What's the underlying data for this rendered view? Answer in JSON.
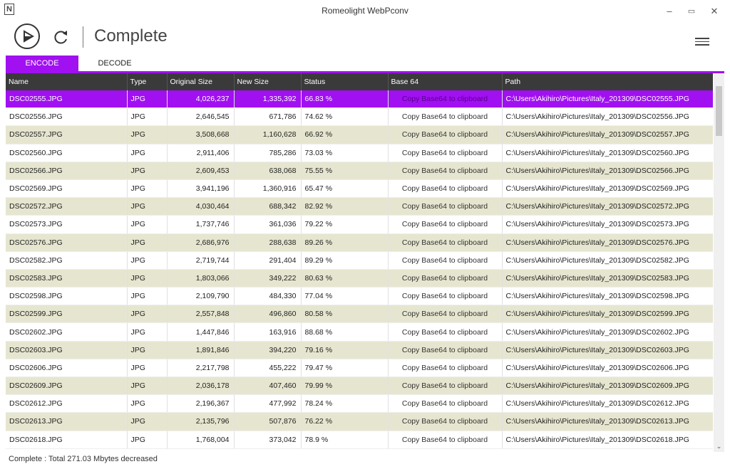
{
  "window": {
    "title": "Romeolight WebPconv",
    "icon": "N",
    "minimize": "–",
    "maximize": "▭",
    "close": "✕"
  },
  "toolbar": {
    "title": "Complete"
  },
  "tabs": [
    {
      "label": "ENCODE",
      "active": true
    },
    {
      "label": "DECODE",
      "active": false
    }
  ],
  "columns": [
    "Name",
    "Type",
    "Original Size",
    "New Size",
    "Status",
    "Base 64",
    "Path"
  ],
  "rows": [
    {
      "name": "DSC02555.JPG",
      "type": "JPG",
      "orig": "4,026,237",
      "new": "1,335,392",
      "status": "66.83 %",
      "b64": "Copy Base64 to clipboard",
      "path": "C:\\Users\\Akihiro\\Pictures\\Italy_201309\\DSC02555.JPG",
      "selected": true
    },
    {
      "name": "DSC02556.JPG",
      "type": "JPG",
      "orig": "2,646,545",
      "new": "671,786",
      "status": "74.62 %",
      "b64": "Copy Base64 to clipboard",
      "path": "C:\\Users\\Akihiro\\Pictures\\Italy_201309\\DSC02556.JPG"
    },
    {
      "name": "DSC02557.JPG",
      "type": "JPG",
      "orig": "3,508,668",
      "new": "1,160,628",
      "status": "66.92 %",
      "b64": "Copy Base64 to clipboard",
      "path": "C:\\Users\\Akihiro\\Pictures\\Italy_201309\\DSC02557.JPG"
    },
    {
      "name": "DSC02560.JPG",
      "type": "JPG",
      "orig": "2,911,406",
      "new": "785,286",
      "status": "73.03 %",
      "b64": "Copy Base64 to clipboard",
      "path": "C:\\Users\\Akihiro\\Pictures\\Italy_201309\\DSC02560.JPG"
    },
    {
      "name": "DSC02566.JPG",
      "type": "JPG",
      "orig": "2,609,453",
      "new": "638,068",
      "status": "75.55 %",
      "b64": "Copy Base64 to clipboard",
      "path": "C:\\Users\\Akihiro\\Pictures\\Italy_201309\\DSC02566.JPG"
    },
    {
      "name": "DSC02569.JPG",
      "type": "JPG",
      "orig": "3,941,196",
      "new": "1,360,916",
      "status": "65.47 %",
      "b64": "Copy Base64 to clipboard",
      "path": "C:\\Users\\Akihiro\\Pictures\\Italy_201309\\DSC02569.JPG"
    },
    {
      "name": "DSC02572.JPG",
      "type": "JPG",
      "orig": "4,030,464",
      "new": "688,342",
      "status": "82.92 %",
      "b64": "Copy Base64 to clipboard",
      "path": "C:\\Users\\Akihiro\\Pictures\\Italy_201309\\DSC02572.JPG"
    },
    {
      "name": "DSC02573.JPG",
      "type": "JPG",
      "orig": "1,737,746",
      "new": "361,036",
      "status": "79.22 %",
      "b64": "Copy Base64 to clipboard",
      "path": "C:\\Users\\Akihiro\\Pictures\\Italy_201309\\DSC02573.JPG"
    },
    {
      "name": "DSC02576.JPG",
      "type": "JPG",
      "orig": "2,686,976",
      "new": "288,638",
      "status": "89.26 %",
      "b64": "Copy Base64 to clipboard",
      "path": "C:\\Users\\Akihiro\\Pictures\\Italy_201309\\DSC02576.JPG"
    },
    {
      "name": "DSC02582.JPG",
      "type": "JPG",
      "orig": "2,719,744",
      "new": "291,404",
      "status": "89.29 %",
      "b64": "Copy Base64 to clipboard",
      "path": "C:\\Users\\Akihiro\\Pictures\\Italy_201309\\DSC02582.JPG"
    },
    {
      "name": "DSC02583.JPG",
      "type": "JPG",
      "orig": "1,803,066",
      "new": "349,222",
      "status": "80.63 %",
      "b64": "Copy Base64 to clipboard",
      "path": "C:\\Users\\Akihiro\\Pictures\\Italy_201309\\DSC02583.JPG"
    },
    {
      "name": "DSC02598.JPG",
      "type": "JPG",
      "orig": "2,109,790",
      "new": "484,330",
      "status": "77.04 %",
      "b64": "Copy Base64 to clipboard",
      "path": "C:\\Users\\Akihiro\\Pictures\\Italy_201309\\DSC02598.JPG"
    },
    {
      "name": "DSC02599.JPG",
      "type": "JPG",
      "orig": "2,557,848",
      "new": "496,860",
      "status": "80.58 %",
      "b64": "Copy Base64 to clipboard",
      "path": "C:\\Users\\Akihiro\\Pictures\\Italy_201309\\DSC02599.JPG"
    },
    {
      "name": "DSC02602.JPG",
      "type": "JPG",
      "orig": "1,447,846",
      "new": "163,916",
      "status": "88.68 %",
      "b64": "Copy Base64 to clipboard",
      "path": "C:\\Users\\Akihiro\\Pictures\\Italy_201309\\DSC02602.JPG"
    },
    {
      "name": "DSC02603.JPG",
      "type": "JPG",
      "orig": "1,891,846",
      "new": "394,220",
      "status": "79.16 %",
      "b64": "Copy Base64 to clipboard",
      "path": "C:\\Users\\Akihiro\\Pictures\\Italy_201309\\DSC02603.JPG"
    },
    {
      "name": "DSC02606.JPG",
      "type": "JPG",
      "orig": "2,217,798",
      "new": "455,222",
      "status": "79.47 %",
      "b64": "Copy Base64 to clipboard",
      "path": "C:\\Users\\Akihiro\\Pictures\\Italy_201309\\DSC02606.JPG"
    },
    {
      "name": "DSC02609.JPG",
      "type": "JPG",
      "orig": "2,036,178",
      "new": "407,460",
      "status": "79.99 %",
      "b64": "Copy Base64 to clipboard",
      "path": "C:\\Users\\Akihiro\\Pictures\\Italy_201309\\DSC02609.JPG"
    },
    {
      "name": "DSC02612.JPG",
      "type": "JPG",
      "orig": "2,196,367",
      "new": "477,992",
      "status": "78.24 %",
      "b64": "Copy Base64 to clipboard",
      "path": "C:\\Users\\Akihiro\\Pictures\\Italy_201309\\DSC02612.JPG"
    },
    {
      "name": "DSC02613.JPG",
      "type": "JPG",
      "orig": "2,135,796",
      "new": "507,876",
      "status": "76.22 %",
      "b64": "Copy Base64 to clipboard",
      "path": "C:\\Users\\Akihiro\\Pictures\\Italy_201309\\DSC02613.JPG"
    },
    {
      "name": "DSC02618.JPG",
      "type": "JPG",
      "orig": "1,768,004",
      "new": "373,042",
      "status": "78.9 %",
      "b64": "Copy Base64 to clipboard",
      "path": "C:\\Users\\Akihiro\\Pictures\\Italy_201309\\DSC02618.JPG"
    }
  ],
  "status": "Complete : Total 271.03 Mbytes decreased",
  "scroll_down": "⌄",
  "colors": {
    "accent": "#a010f0",
    "header_bg": "#3a3a3a",
    "alt_row": "#e6e6d0"
  }
}
